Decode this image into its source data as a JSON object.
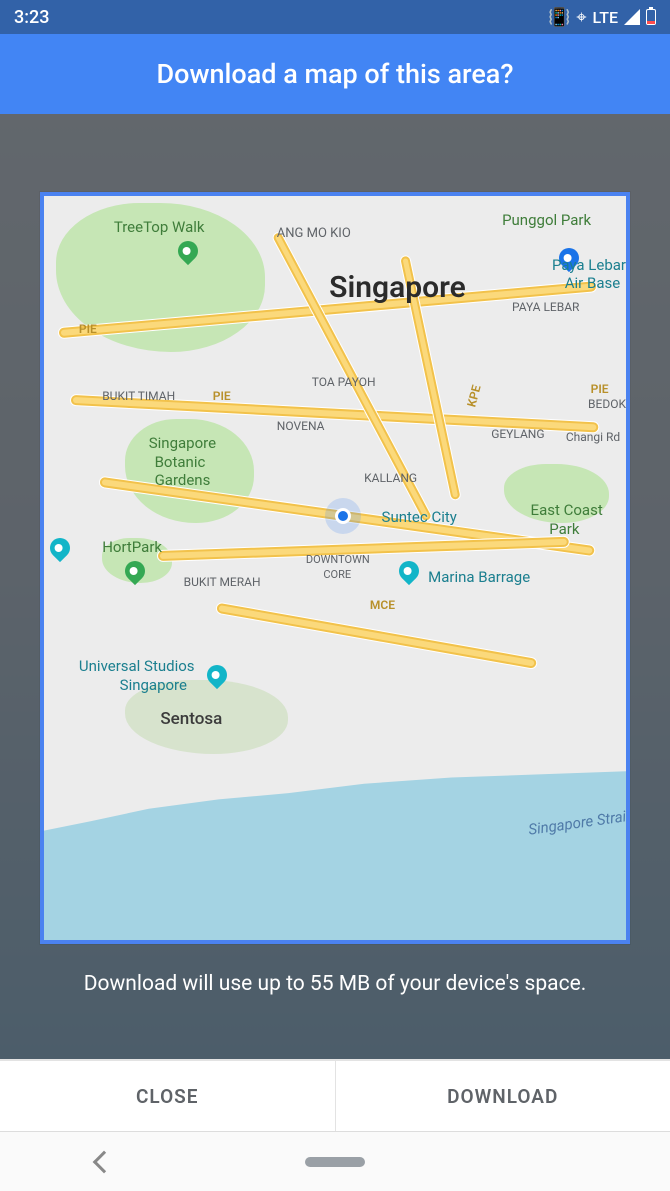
{
  "status": {
    "time": "3:23",
    "network": "LTE"
  },
  "header": {
    "title": "Download a map of this area?"
  },
  "map": {
    "city": "Singapore",
    "labels": {
      "treetop_walk": "TreeTop Walk",
      "ang_mo_kio": "ANG MO KIO",
      "punggol_park": "Punggol Park",
      "paya_lebar_airbase_1": "Paya Lebar",
      "paya_lebar_airbase_2": "Air Base",
      "paya_lebar": "PAYA LEBAR",
      "toa_payoh": "TOA PAYOH",
      "bukit_timah": "BUKIT TIMAH",
      "novena": "NOVENA",
      "geylang": "GEYLANG",
      "changi_rd": "Changi Rd",
      "bedok": "BEDOK",
      "botanic_1": "Singapore",
      "botanic_2": "Botanic",
      "botanic_3": "Gardens",
      "kallang": "KALLANG",
      "suntec": "Suntec City",
      "east_coast_1": "East Coast",
      "east_coast_2": "Park",
      "hortpark": "HortPark",
      "bukit_merah": "BUKIT MERAH",
      "downtown_1": "DOWNTOWN",
      "downtown_2": "CORE",
      "marina_barrage": "Marina Barrage",
      "universal_1": "Universal Studios",
      "universal_2": "Singapore",
      "sentosa": "Sentosa",
      "singapore_strait": "Singapore Strai",
      "pie": "PIE",
      "pie2": "PIE",
      "pie3": "PIE",
      "kpe": "KPE",
      "mce": "MCE"
    }
  },
  "info": {
    "text": "Download will use up to 55 MB of your device's space."
  },
  "buttons": {
    "close": "CLOSE",
    "download": "DOWNLOAD"
  }
}
